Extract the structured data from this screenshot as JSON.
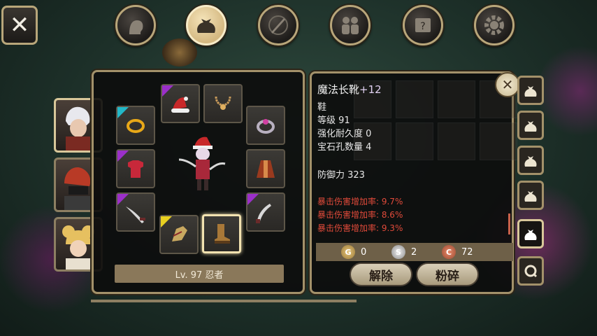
{
  "nav": {
    "close_label": "✕",
    "tabs": [
      {
        "name": "character",
        "icon": "head-silhouette-icon"
      },
      {
        "name": "inventory",
        "icon": "bag-icon",
        "active": true
      },
      {
        "name": "skills",
        "icon": "sword-compass-icon"
      },
      {
        "name": "party",
        "icon": "people-icon"
      },
      {
        "name": "quest",
        "icon": "scroll-icon"
      },
      {
        "name": "settings",
        "icon": "gear-icon"
      }
    ]
  },
  "character": {
    "level_label": "Lv. 97 忍者"
  },
  "item": {
    "name": "魔法长靴",
    "enhance": "+12",
    "type": "鞋",
    "level": "等级 91",
    "durability_label": "强化耐久度",
    "durability_value": "0",
    "sockets_label": "宝石孔数量",
    "sockets_value": "4",
    "defense": "防御力 323",
    "bonuses": [
      "暴击伤害增加率: 9.7%",
      "暴击伤害增加率: 8.6%",
      "暴击伤害增加率: 9.3%"
    ]
  },
  "currency": {
    "gold": "0",
    "silver": "2",
    "bronze": "72",
    "gold_symbol": "G",
    "silver_symbol": "S",
    "bronze_symbol": "C"
  },
  "buttons": {
    "unequip": "解除",
    "smash": "粉碎"
  },
  "colors": {
    "accent": "#a3916a",
    "bonus_red": "#e04a3a",
    "enhance_purple": "#c58af0",
    "rarity_purple": "#9b2fc9",
    "rarity_cyan": "#22b8c8",
    "rarity_yellow": "#e8d020"
  }
}
